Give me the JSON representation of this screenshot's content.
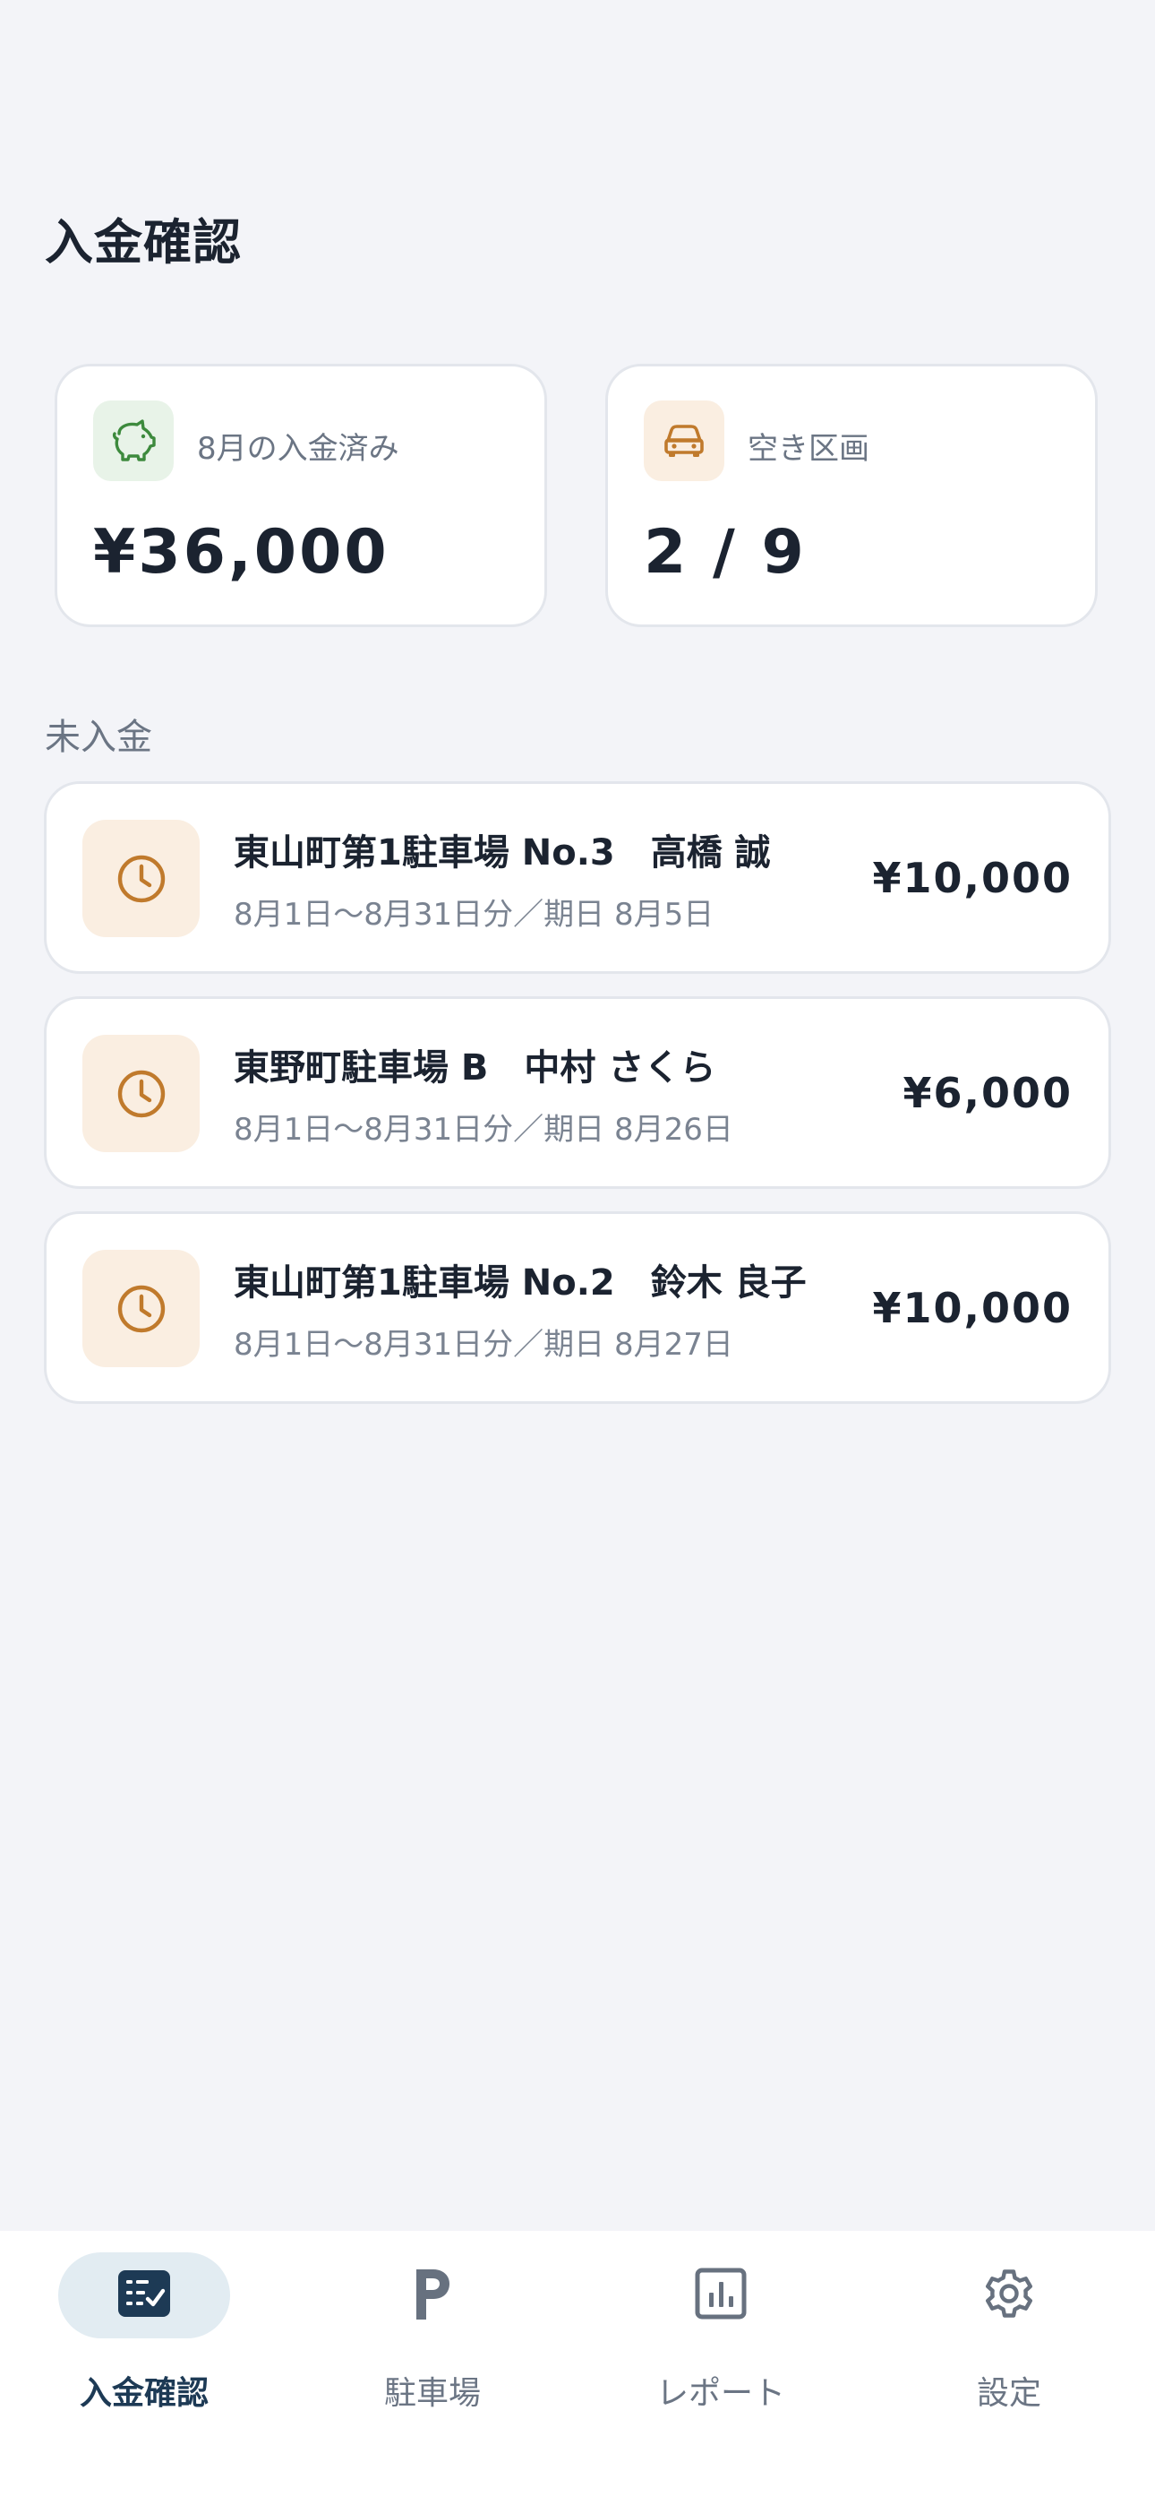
{
  "page": {
    "title": "入金確認"
  },
  "stats": [
    {
      "label": "8月の入金済み",
      "value": "¥36,000",
      "icon": "piggy-bank-icon",
      "accent": "#3d8a3d"
    },
    {
      "label": "空き区画",
      "value": "2 / 9",
      "icon": "car-icon",
      "accent": "#c07a2c"
    }
  ],
  "unpaid": {
    "label": "未入金",
    "items": [
      {
        "title": "東山町第1駐車場 No.3　高橋 誠",
        "sub": "8月1日〜8月31日分／期日 8月5日",
        "amount": "¥10,000",
        "icon": "clock-icon"
      },
      {
        "title": "東野町駐車場 B　中村 さくら",
        "sub": "8月1日〜8月31日分／期日 8月26日",
        "amount": "¥6,000",
        "icon": "clock-icon"
      },
      {
        "title": "東山町第1駐車場 No.2　鈴木 良子",
        "sub": "8月1日〜8月31日分／期日 8月27日",
        "amount": "¥10,000",
        "icon": "clock-icon"
      }
    ]
  },
  "nav": {
    "items": [
      {
        "label": "入金確認",
        "icon": "checklist-icon",
        "active": true
      },
      {
        "label": "駐車場",
        "icon": "parking-icon",
        "active": false
      },
      {
        "label": "レポート",
        "icon": "bar-chart-icon",
        "active": false
      },
      {
        "label": "設定",
        "icon": "gear-icon",
        "active": false
      }
    ]
  },
  "colors": {
    "background": "#f3f4f8",
    "active_nav": "#1d3a55",
    "muted_text": "#6b7584",
    "warning_bg": "#faeee1",
    "warning_icon": "#c07a2c"
  }
}
